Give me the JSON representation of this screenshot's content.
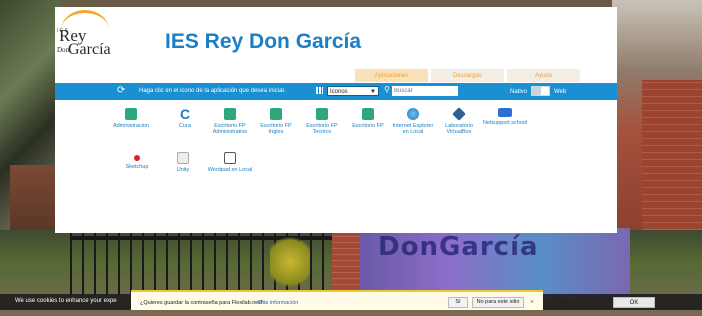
{
  "site": {
    "title": "IES Rey Don García",
    "logo": {
      "small": "I E S",
      "rey": "Rey",
      "don": "Don",
      "garcia": "García"
    }
  },
  "tabs": [
    {
      "label": "Aplicaciones",
      "active": true
    },
    {
      "label": "Descargas",
      "active": false
    },
    {
      "label": "Ayuda",
      "active": false
    }
  ],
  "toolbar": {
    "refresh_icon": "refresh-icon",
    "message": "Haga clic en el icono de la aplicación que desea iniciar.",
    "view_selected": "Iconos",
    "search_placeholder": "Buscar",
    "nativo_label": "Nativo",
    "web_label": "Web"
  },
  "apps": [
    {
      "label": "Administracion",
      "icon": "download-icon"
    },
    {
      "label": "Cura",
      "icon": "cura-icon"
    },
    {
      "label": "Escritorio FP Administrativo",
      "icon": "download-icon"
    },
    {
      "label": "Escritorio FP Ingles",
      "icon": "download-icon"
    },
    {
      "label": "Escritorio FP Tecnico",
      "icon": "download-icon"
    },
    {
      "label": "Escritorio FP",
      "icon": "download-icon"
    },
    {
      "label": "Internet Explorer en Local",
      "icon": "internet-explorer-icon"
    },
    {
      "label": "Laboratorio VirtualBox",
      "icon": "virtualbox-icon"
    },
    {
      "label": "Netsupport school",
      "icon": "monitor-icon"
    },
    {
      "label": "Sketchup",
      "icon": "sketchup-icon"
    },
    {
      "label": "Unity",
      "icon": "unity-icon"
    },
    {
      "label": "Wordpad en Local",
      "icon": "wordpad-icon"
    }
  ],
  "cookie": {
    "text": "We use cookies to enhance your expe",
    "ok": "OK"
  },
  "password_bar": {
    "text": "¿Quieres guardar la contraseña para Flexilab.net?",
    "more": "Más información",
    "yes": "Sí",
    "no": "No para este sitio",
    "close": "×"
  },
  "background": {
    "mural_text": "DonGarcía"
  }
}
